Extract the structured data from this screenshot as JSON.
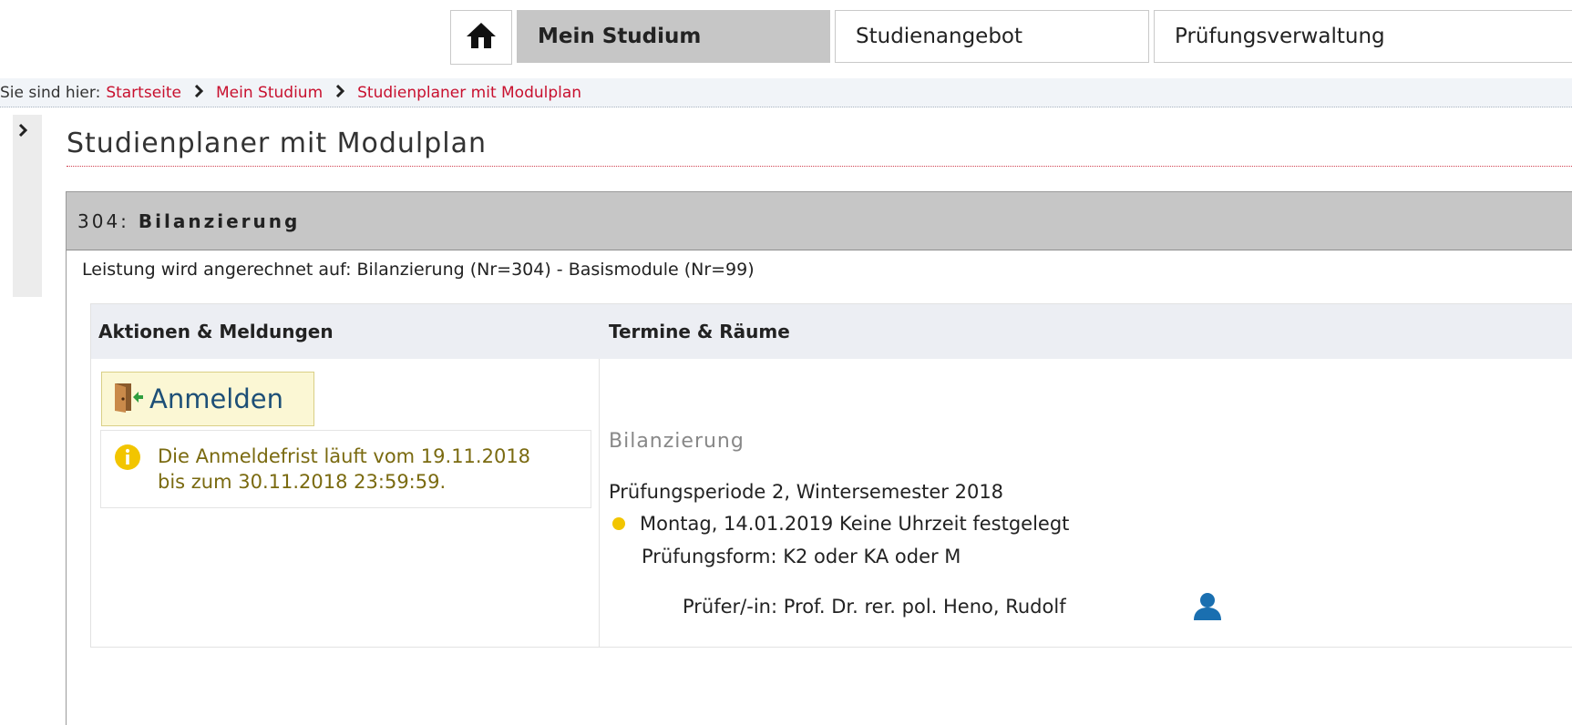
{
  "nav": {
    "home_icon": "home-icon",
    "tabs": [
      {
        "label": "Mein Studium",
        "active": true
      },
      {
        "label": "Studienangebot",
        "active": false
      },
      {
        "label": "Prüfungsverwaltung",
        "active": false
      }
    ]
  },
  "breadcrumb": {
    "prefix": "Sie sind hier:",
    "items": [
      "Startseite",
      "Mein Studium",
      "Studienplaner mit Modulplan"
    ],
    "separator_icon": "chevron-right-icon"
  },
  "page": {
    "title": "Studienplaner mit Modulplan"
  },
  "module": {
    "number": "304:",
    "name": "Bilanzierung",
    "credit_line": "Leistung wird angerechnet auf: Bilanzierung (Nr=304) - Basismodule (Nr=99)",
    "columns": [
      "Aktionen & Meldungen",
      "Termine & Räume"
    ],
    "action": {
      "label": "Anmelden",
      "icon": "door-enter-icon"
    },
    "info": {
      "icon": "info-icon",
      "line1": "Die Anmeldefrist läuft vom 19.11.2018",
      "line2": "bis zum 30.11.2018 23:59:59."
    },
    "exam": {
      "title": "Bilanzierung",
      "period": "Prüfungsperiode 2, Wintersemester 2018",
      "date": "Montag, 14.01.2019 Keine Uhrzeit festgelegt",
      "form": "Prüfungsform: K2 oder KA oder M",
      "examiner": "Prüfer/-in: Prof. Dr. rer. pol. Heno, Rudolf",
      "examiner_icon": "person-icon"
    }
  },
  "colors": {
    "breadcrumb_link": "#c8102e",
    "active_tab": "#c6c6c6",
    "info_text": "#7a6a10",
    "status_dot": "#f2c500",
    "person_icon": "#1a6fb0"
  }
}
